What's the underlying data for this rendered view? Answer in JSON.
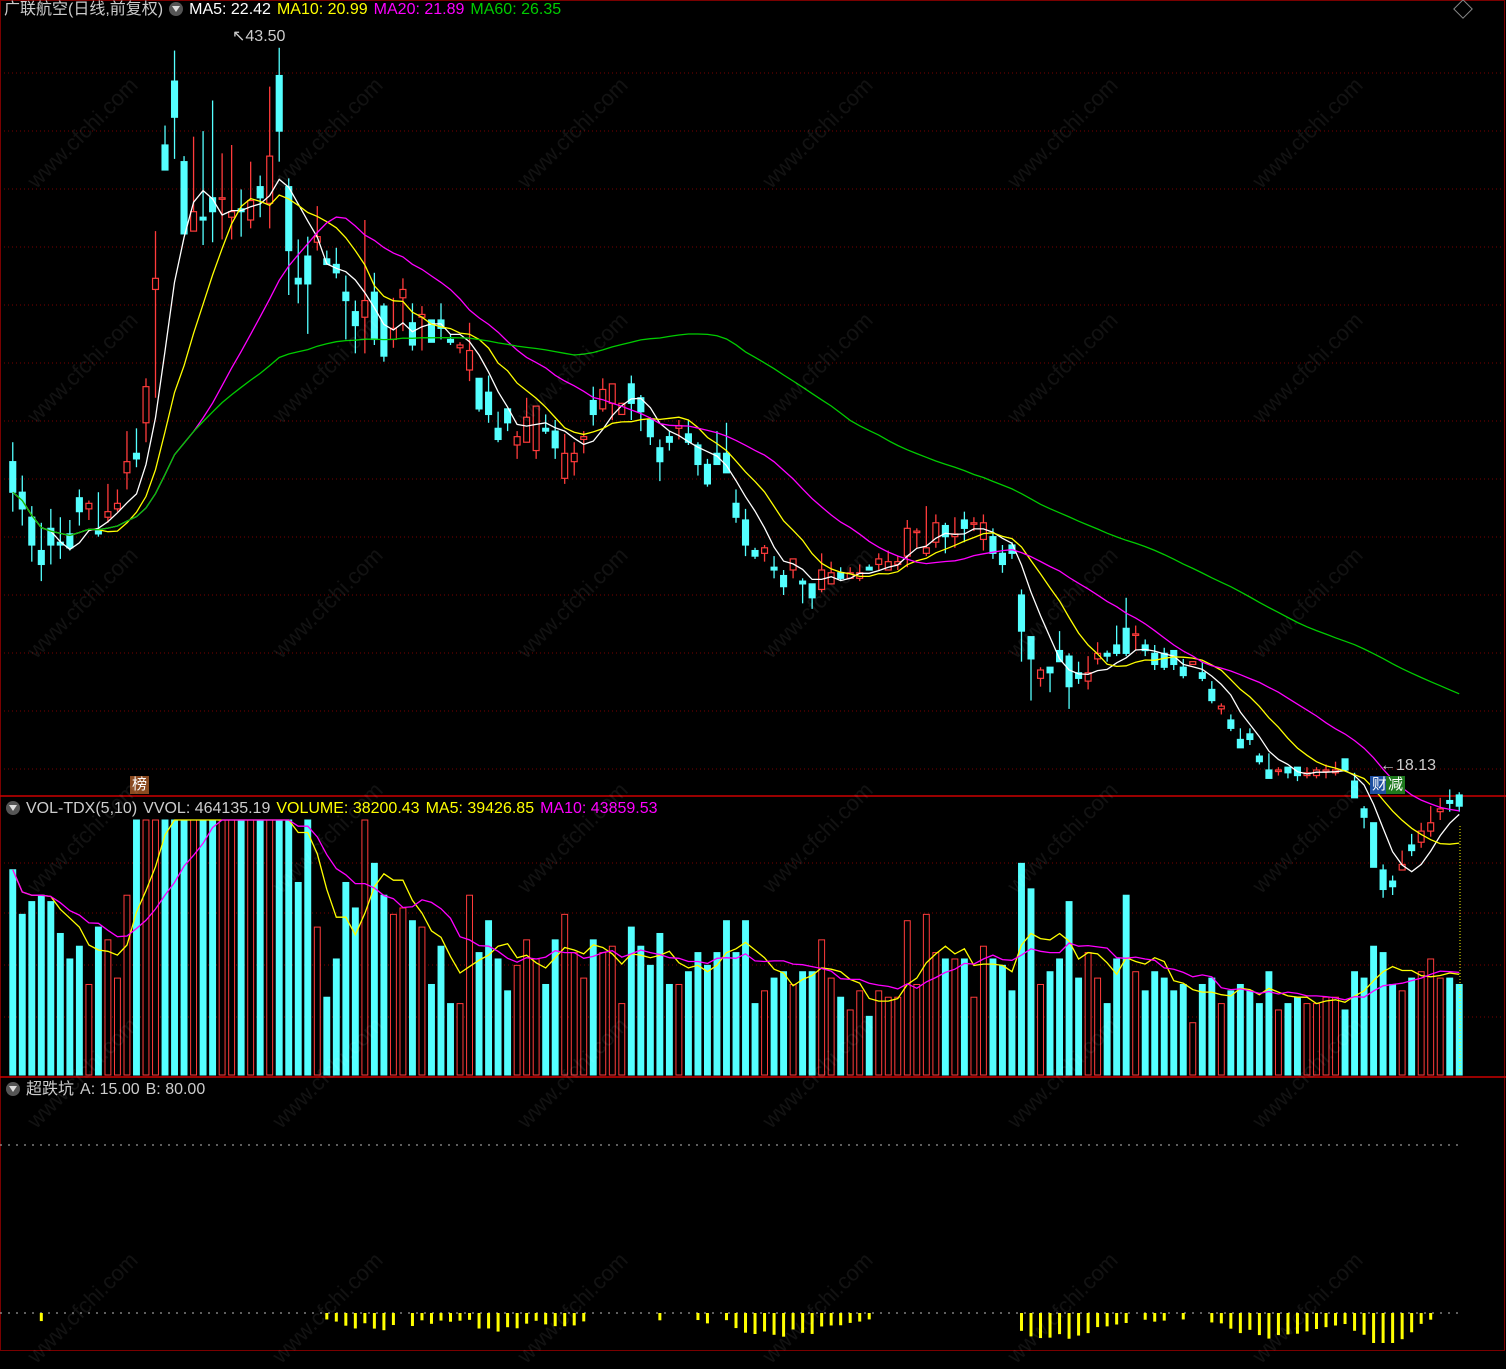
{
  "main_header": {
    "stock": "广联航空(日线,前复权)",
    "ma5": "MA5: 22.42",
    "ma10": "MA10: 20.99",
    "ma20": "MA20: 21.89",
    "ma60": "MA60: 26.35"
  },
  "vol_header": {
    "name": "VOL-TDX(5,10)",
    "vvol": "VVOL: 464135.19",
    "volume": "VOLUME: 38200.43",
    "ma5": "MA5: 39426.85",
    "ma10": "MA10: 43859.53"
  },
  "ind_header": {
    "name": "超跌坑",
    "a": "A: 15.00",
    "b": "B: 80.00"
  },
  "annotations": {
    "high": "43.50",
    "low": "18.13",
    "tag_bang": "榜",
    "tag_cai": "财",
    "tag_jian": "减"
  },
  "watermark": "www.cfchi.com",
  "colors": {
    "up": "#ff3b3b",
    "down": "#54ffff",
    "ma5": "#ffffff",
    "ma10": "#ffff00",
    "ma20": "#ff00ff",
    "ma60": "#00cc00",
    "grid": "#7a0000",
    "indicator": "#ffff00"
  },
  "chart_data": {
    "type": "candlestick",
    "price_range": [
      17.5,
      44.5
    ],
    "candles": [
      [
        28.6,
        27.5,
        29.3,
        26.8
      ],
      [
        27.5,
        26.9,
        28.1,
        26.3
      ],
      [
        26.6,
        25.6,
        27.0,
        25.0
      ],
      [
        25.4,
        24.9,
        26.4,
        24.3
      ],
      [
        26.2,
        25.6,
        26.9,
        24.9
      ],
      [
        25.7,
        25.6,
        26.6,
        25.1
      ],
      [
        26.0,
        25.5,
        26.5,
        25.4
      ],
      [
        27.3,
        26.8,
        27.6,
        26.3
      ],
      [
        26.9,
        27.1,
        27.2,
        26.5
      ],
      [
        26.1,
        26.0,
        27.5,
        25.9
      ],
      [
        26.6,
        26.8,
        27.8,
        26.4
      ],
      [
        26.9,
        27.1,
        27.6,
        26.8
      ],
      [
        28.2,
        28.6,
        29.7,
        27.6
      ],
      [
        28.9,
        28.7,
        29.8,
        28.4
      ],
      [
        30.0,
        31.3,
        31.6,
        29.3
      ],
      [
        34.8,
        35.2,
        36.9,
        30.9
      ],
      [
        40.0,
        39.1,
        40.7,
        39.5
      ],
      [
        42.3,
        41.0,
        43.4,
        39.5
      ],
      [
        39.4,
        36.8,
        39.6,
        37.1
      ],
      [
        36.9,
        37.6,
        40.3,
        37.4
      ],
      [
        37.4,
        37.3,
        40.5,
        36.4
      ],
      [
        38.1,
        37.6,
        41.6,
        36.5
      ],
      [
        38.1,
        38.1,
        39.7,
        36.6
      ],
      [
        37.4,
        37.6,
        40.0,
        36.6
      ],
      [
        37.7,
        37.6,
        38.4,
        36.7
      ],
      [
        37.3,
        38.0,
        39.4,
        37.0
      ],
      [
        38.5,
        38.1,
        38.9,
        37.4
      ],
      [
        37.9,
        39.6,
        42.1,
        37.0
      ],
      [
        42.5,
        40.5,
        43.5,
        39.4
      ],
      [
        38.5,
        36.2,
        38.8,
        34.6
      ],
      [
        35.2,
        35.0,
        36.6,
        34.3
      ],
      [
        36.0,
        35.0,
        36.7,
        33.2
      ],
      [
        36.5,
        36.7,
        37.8,
        36.2
      ],
      [
        35.9,
        35.7,
        36.2,
        35.7
      ],
      [
        35.7,
        35.4,
        36.3,
        35.2
      ],
      [
        34.7,
        34.4,
        35.3,
        33.0
      ],
      [
        34.0,
        33.5,
        34.4,
        32.5
      ],
      [
        33.8,
        34.4,
        37.3,
        32.5
      ],
      [
        34.7,
        33.0,
        35.4,
        32.8
      ],
      [
        34.2,
        32.4,
        34.3,
        32.2
      ],
      [
        33.0,
        33.4,
        34.5,
        32.7
      ],
      [
        34.5,
        34.8,
        35.2,
        33.3
      ],
      [
        33.6,
        32.8,
        34.3,
        32.6
      ],
      [
        33.8,
        33.9,
        34.2,
        32.6
      ],
      [
        33.7,
        32.9,
        33.6,
        32.9
      ],
      [
        33.7,
        33.4,
        34.3,
        33.0
      ],
      [
        33.0,
        32.9,
        33.2,
        32.8
      ],
      [
        32.7,
        32.8,
        32.9,
        32.5
      ],
      [
        31.9,
        32.6,
        33.6,
        31.5
      ],
      [
        31.6,
        30.5,
        31.6,
        30.4
      ],
      [
        31.1,
        30.3,
        31.7,
        30.0
      ],
      [
        29.8,
        29.4,
        30.4,
        29.3
      ],
      [
        30.5,
        30.0,
        30.3,
        29.7
      ],
      [
        29.2,
        29.5,
        29.7,
        28.7
      ],
      [
        29.3,
        30.2,
        30.9,
        29.5
      ],
      [
        29.0,
        30.6,
        29.8,
        28.7
      ],
      [
        29.8,
        29.7,
        30.3,
        29.6
      ],
      [
        29.7,
        29.1,
        30.1,
        28.7
      ],
      [
        28.0,
        28.9,
        29.6,
        27.8
      ],
      [
        28.6,
        28.9,
        29.3,
        28.1
      ],
      [
        29.4,
        29.5,
        29.7,
        28.9
      ],
      [
        30.8,
        30.3,
        31.3,
        29.9
      ],
      [
        30.5,
        31.2,
        31.6,
        30.4
      ],
      [
        30.7,
        31.4,
        31.4,
        30.1
      ],
      [
        30.3,
        30.7,
        30.7,
        30.3
      ],
      [
        31.4,
        30.7,
        31.7,
        30.1
      ],
      [
        30.9,
        30.4,
        31.0,
        29.7
      ],
      [
        30.1,
        29.5,
        30.2,
        29.2
      ],
      [
        29.1,
        28.6,
        29.4,
        27.9
      ],
      [
        29.5,
        29.3,
        29.7,
        29.0
      ],
      [
        29.8,
        29.9,
        30.1,
        29.4
      ],
      [
        29.6,
        29.3,
        30.1,
        29.2
      ],
      [
        29.2,
        28.5,
        29.3,
        28.1
      ],
      [
        28.5,
        27.8,
        28.7,
        27.7
      ],
      [
        28.9,
        28.5,
        29.7,
        28.5
      ],
      [
        28.9,
        28.2,
        30.0,
        28.3
      ],
      [
        27.1,
        26.6,
        27.6,
        26.4
      ],
      [
        26.5,
        25.6,
        26.9,
        25.2
      ],
      [
        25.4,
        25.2,
        25.5,
        25.1
      ],
      [
        25.3,
        25.5,
        25.6,
        25.0
      ],
      [
        24.8,
        24.7,
        25.2,
        24.4
      ],
      [
        24.5,
        24.1,
        24.7,
        23.8
      ],
      [
        24.7,
        25.1,
        25.1,
        24.4
      ],
      [
        24.3,
        24.2,
        24.4,
        23.5
      ],
      [
        24.2,
        23.7,
        24.2,
        23.3
      ],
      [
        24.0,
        24.7,
        25.3,
        23.9
      ],
      [
        24.2,
        24.6,
        25.0,
        24.2
      ],
      [
        24.6,
        24.4,
        24.8,
        24.3
      ],
      [
        24.4,
        24.6,
        24.8,
        24.5
      ],
      [
        24.4,
        24.6,
        24.9,
        24.3
      ],
      [
        24.8,
        24.7,
        24.9,
        24.7
      ],
      [
        24.9,
        25.1,
        25.3,
        24.7
      ],
      [
        24.7,
        25.0,
        25.4,
        24.9
      ],
      [
        24.9,
        25.0,
        25.2,
        24.7
      ],
      [
        25.2,
        26.2,
        26.5,
        24.8
      ],
      [
        26.1,
        26.1,
        26.2,
        25.5
      ],
      [
        25.3,
        25.5,
        27.0,
        25.2
      ],
      [
        25.7,
        26.4,
        26.7,
        25.5
      ],
      [
        26.3,
        25.9,
        26.4,
        25.3
      ],
      [
        25.9,
        26.0,
        26.6,
        25.5
      ],
      [
        26.5,
        26.2,
        26.8,
        25.7
      ],
      [
        26.4,
        26.4,
        26.6,
        26.1
      ],
      [
        25.8,
        26.4,
        26.7,
        25.4
      ],
      [
        25.9,
        25.3,
        26.2,
        25.1
      ],
      [
        25.3,
        24.9,
        25.6,
        24.6
      ],
      [
        25.6,
        25.3,
        25.7,
        25.1
      ],
      [
        23.8,
        22.5,
        24.0,
        21.4
      ],
      [
        22.3,
        21.5,
        22.2,
        20.0
      ],
      [
        20.8,
        21.1,
        21.2,
        20.5
      ],
      [
        21.2,
        21.0,
        21.2,
        20.3
      ],
      [
        21.8,
        21.4,
        22.5,
        21.4
      ],
      [
        21.6,
        20.5,
        21.7,
        19.7
      ],
      [
        21.0,
        20.8,
        21.4,
        20.6
      ],
      [
        20.7,
        21.0,
        21.6,
        20.4
      ],
      [
        21.5,
        21.7,
        22.1,
        21.3
      ],
      [
        21.7,
        21.6,
        21.8,
        21.4
      ],
      [
        22.0,
        21.7,
        22.7,
        21.6
      ],
      [
        22.6,
        21.7,
        23.7,
        21.6
      ],
      [
        22.4,
        22.4,
        22.7,
        21.8
      ],
      [
        22.0,
        21.8,
        22.2,
        21.6
      ],
      [
        21.7,
        21.3,
        22.0,
        21.1
      ],
      [
        21.7,
        21.2,
        21.9,
        21.1
      ],
      [
        21.8,
        21.3,
        21.7,
        21.1
      ],
      [
        21.2,
        20.9,
        21.5,
        20.8
      ],
      [
        21.3,
        21.4,
        21.4,
        21.3
      ],
      [
        21.0,
        20.8,
        21.4,
        20.7
      ],
      [
        20.4,
        20.0,
        20.7,
        19.9
      ],
      [
        19.7,
        19.8,
        19.9,
        19.5
      ],
      [
        19.3,
        19.0,
        19.5,
        18.9
      ],
      [
        18.6,
        18.3,
        19.0,
        18.3
      ],
      [
        18.8,
        18.6,
        19.0,
        18.4
      ],
      [
        18.0,
        17.8,
        18.1,
        17.7
      ],
      [
        17.5,
        17.2,
        18.1,
        17.2
      ],
      [
        17.5,
        17.5,
        17.6,
        17.3
      ],
      [
        17.6,
        17.4,
        17.6,
        17.2
      ],
      [
        17.6,
        17.3,
        17.6,
        17.1
      ],
      [
        17.3,
        17.4,
        17.6,
        17.2
      ],
      [
        17.3,
        17.5,
        17.6,
        17.2
      ],
      [
        17.5,
        17.5,
        17.7,
        17.2
      ],
      [
        17.4,
        17.5,
        17.8,
        17.3
      ],
      [
        17.9,
        17.5,
        17.8,
        17.5
      ],
      [
        17.1,
        16.5,
        17.4,
        16.5
      ],
      [
        16.1,
        15.8,
        16.2,
        15.4
      ],
      [
        15.6,
        14.0,
        15.6,
        14.3
      ],
      [
        13.9,
        13.2,
        14.1,
        12.9
      ],
      [
        13.5,
        13.3,
        13.7,
        13.0
      ],
      [
        13.9,
        14.1,
        14.6,
        14.0
      ],
      [
        14.8,
        14.6,
        15.2,
        14.4
      ],
      [
        14.9,
        15.3,
        15.6,
        14.7
      ],
      [
        15.3,
        15.6,
        16.2,
        15.1
      ],
      [
        16.0,
        16.1,
        16.5,
        15.7
      ],
      [
        16.4,
        16.3,
        16.8,
        16.0
      ],
      [
        16.6,
        16.2,
        16.7,
        16.0
      ]
    ],
    "volume": [],
    "ma_labels": [
      "MA5",
      "MA10",
      "MA20",
      "MA60"
    ]
  }
}
